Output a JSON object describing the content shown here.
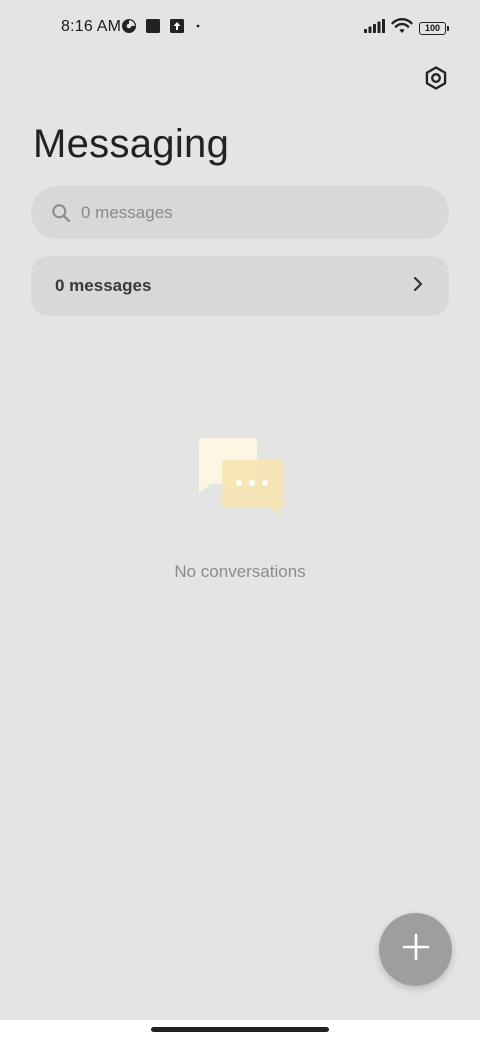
{
  "status_bar": {
    "time": "8:16 AM",
    "battery": "100",
    "left_icons": [
      "data-saver-icon",
      "square-notification-icon",
      "upload-icon",
      "dot-icon"
    ],
    "right_icons": [
      "signal-icon",
      "wifi-icon",
      "battery-icon"
    ]
  },
  "header": {
    "title": "Messaging",
    "settings_icon": "settings-hexagon-icon"
  },
  "search": {
    "placeholder": "0 messages",
    "value": ""
  },
  "messages_row": {
    "label": "0 messages",
    "chevron_icon": "chevron-right-icon"
  },
  "empty_state": {
    "text": "No conversations",
    "icon": "chat-bubbles-icon"
  },
  "fab": {
    "icon": "plus-icon"
  },
  "colors": {
    "background": "#e4e4e4",
    "surface": "#d8d8d8",
    "fab": "#9e9e9e",
    "bubble_back": "#fdf6e3",
    "bubble_front": "#f6e4b0"
  }
}
